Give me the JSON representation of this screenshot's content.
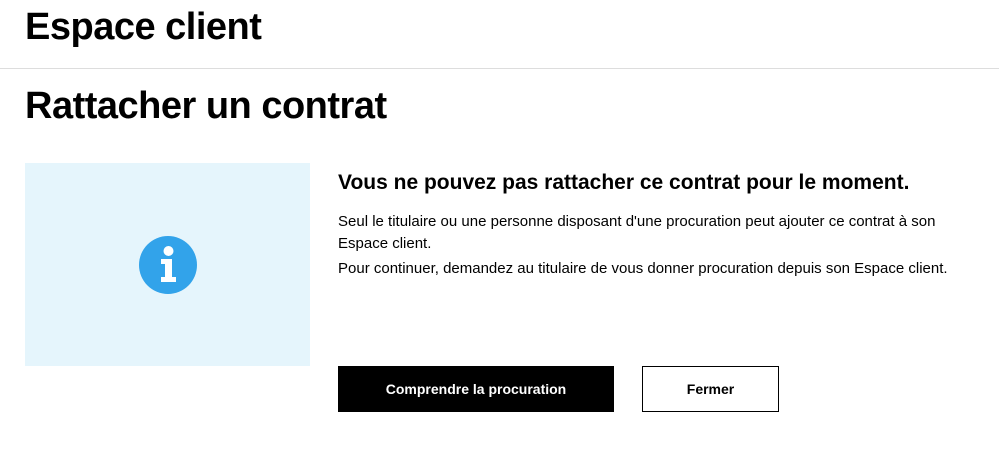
{
  "header": {
    "app_title": "Espace client"
  },
  "page": {
    "title": "Rattacher un contrat"
  },
  "info_panel": {
    "icon": "info-icon",
    "icon_color": "#32a3ea",
    "background_color": "#e5f5fc"
  },
  "message": {
    "title": "Vous ne pouvez pas rattacher ce contrat pour le moment.",
    "paragraph_1": "Seul le titulaire ou une personne disposant d'une procuration peut ajouter ce contrat à son Espace client.",
    "paragraph_2": "Pour continuer, demandez au titulaire de vous donner procuration depuis son Espace client."
  },
  "actions": {
    "primary_label": "Comprendre la procuration",
    "secondary_label": "Fermer"
  }
}
